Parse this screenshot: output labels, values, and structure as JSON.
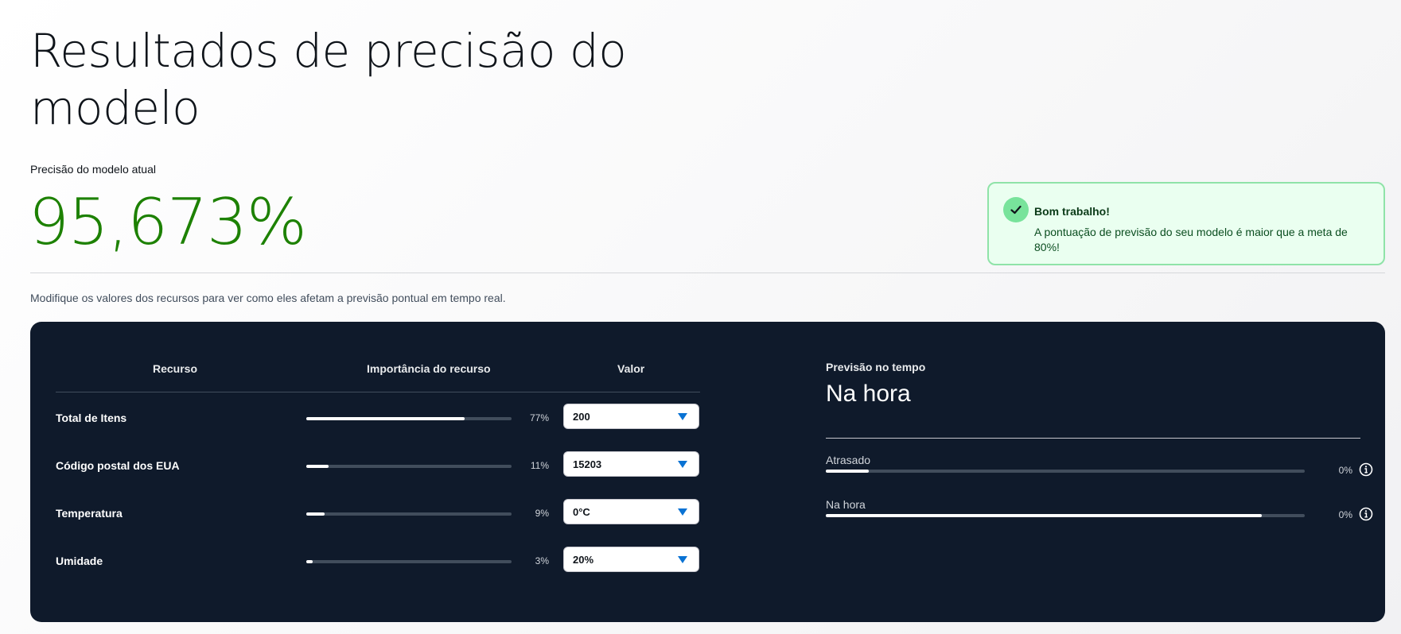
{
  "page": {
    "title": "Resultados de precisão do modelo",
    "accuracy_label": "Precisão do modelo atual",
    "accuracy_value": "95,673%",
    "accuracy_color": "#1d8102",
    "instruction": "Modifique os valores dos recursos para ver como eles afetam a previsão pontual em tempo real."
  },
  "alert": {
    "icon": "check-icon",
    "title": "Bom trabalho!",
    "message": "A pontuação de previsão do seu modelo é maior que a meta de 80%!"
  },
  "features_table": {
    "headers": {
      "feature": "Recurso",
      "importance": "Importância do recurso",
      "value": "Valor"
    },
    "rows": [
      {
        "name": "Total de Itens",
        "importance": 0.77,
        "importance_label": "77%",
        "value": "200"
      },
      {
        "name": "Código postal dos EUA",
        "importance": 0.11,
        "importance_label": "11%",
        "value": "15203"
      },
      {
        "name": "Temperatura",
        "importance": 0.09,
        "importance_label": "9%",
        "value": "0°C"
      },
      {
        "name": "Umidade",
        "importance": 0.03,
        "importance_label": "3%",
        "value": "20%"
      }
    ]
  },
  "prediction": {
    "label": "Previsão no tempo",
    "value": "Na hora",
    "probabilities": [
      {
        "label": "Atrasado",
        "fraction": 0.09,
        "pct_label": "0%",
        "icon": "info-icon"
      },
      {
        "label": "Na hora",
        "fraction": 0.91,
        "pct_label": "0%",
        "icon": "info-icon"
      }
    ]
  },
  "colors": {
    "panel_bg": "#0f1a2b",
    "success_bg": "#eafff0",
    "success_border": "#8fe3a8",
    "select_caret": "#0972d3"
  }
}
